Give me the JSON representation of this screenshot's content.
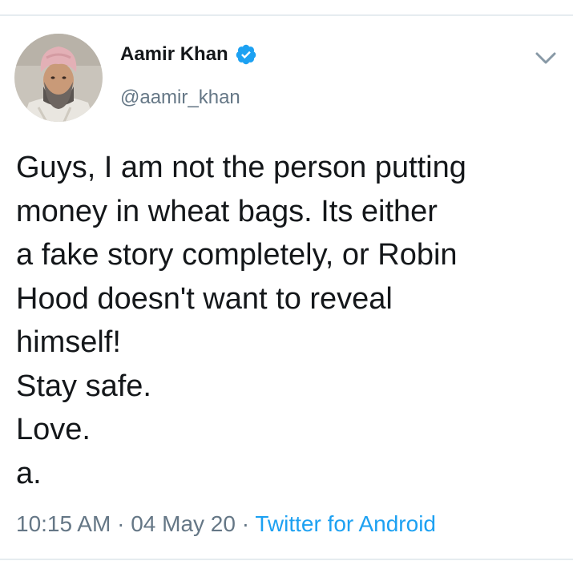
{
  "author": {
    "display_name": "Aamir Khan",
    "handle": "@aamir_khan",
    "verified": true
  },
  "tweet": {
    "text": "Guys, I am not the person putting\nmoney in wheat bags. Its either\na fake story completely, or Robin\nHood doesn't want to reveal\nhimself!\nStay safe.\nLove.\na.",
    "time": "10:15 AM",
    "separator": "·",
    "date": "04 May 20",
    "source": "Twitter for Android"
  },
  "icons": {
    "verified": "verified-badge-icon",
    "menu": "chevron-down-icon",
    "avatar": "profile-photo"
  },
  "colors": {
    "text": "#14171a",
    "secondary": "#657786",
    "link": "#1da1f2",
    "divider": "#e6ecf0"
  }
}
